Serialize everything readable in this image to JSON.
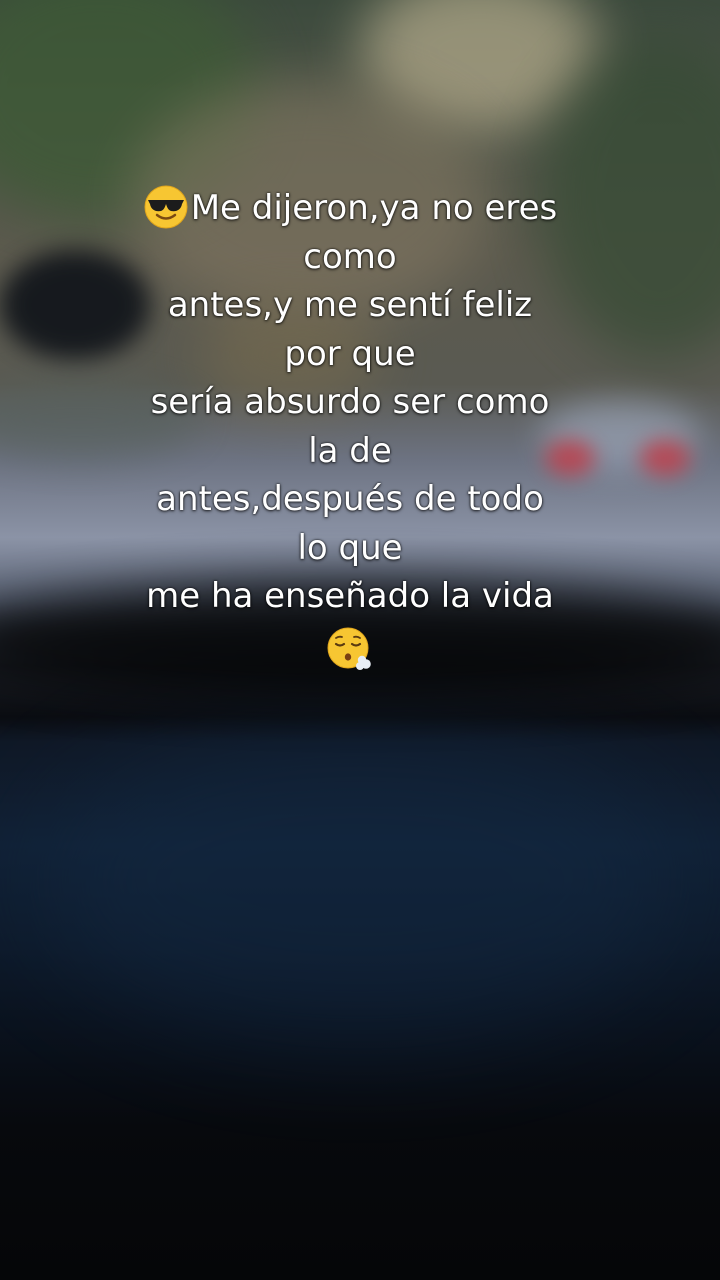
{
  "caption": {
    "emoji_start": "sunglasses-face-icon",
    "lines": [
      "Me dijeron,ya no eres",
      "como",
      "antes,y me sentí feliz",
      "por que",
      "sería absurdo ser como",
      "la de",
      "antes,después de todo",
      "lo que",
      "me ha enseñado la vida"
    ],
    "emoji_end": "face-exhaling-icon"
  }
}
